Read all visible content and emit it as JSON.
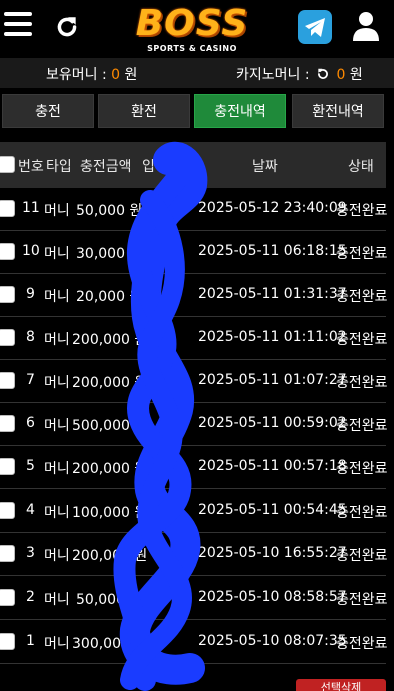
{
  "header": {
    "logo_text": "BOSS",
    "logo_subtext": "SPORTS & CASINO"
  },
  "balance": {
    "holding_label": "보유머니 :",
    "holding_value": "0",
    "holding_unit": "원",
    "casino_label": "카지노머니 :",
    "casino_value": "0",
    "casino_unit": "원"
  },
  "tabs": [
    {
      "label": "충전"
    },
    {
      "label": "환전"
    },
    {
      "label": "충전내역"
    },
    {
      "label": "환전내역"
    }
  ],
  "table": {
    "headers": {
      "no": "번호",
      "type": "타입",
      "amount": "충전금액",
      "in": "입",
      "date": "날짜",
      "status": "상태"
    },
    "rows": [
      {
        "no": "11",
        "type": "머니",
        "amount": "50,000 원",
        "date": "2025-05-12 23:40:09",
        "status": "충전완료"
      },
      {
        "no": "10",
        "type": "머니",
        "amount": "30,000 원",
        "date": "2025-05-11 06:18:15",
        "status": "충전완료"
      },
      {
        "no": "9",
        "type": "머니",
        "amount": "20,000 원",
        "date": "2025-05-11 01:31:37",
        "status": "충전완료"
      },
      {
        "no": "8",
        "type": "머니",
        "amount": "200,000 원",
        "date": "2025-05-11 01:11:02",
        "status": "충전완료"
      },
      {
        "no": "7",
        "type": "머니",
        "amount": "200,000 원",
        "date": "2025-05-11 01:07:27",
        "status": "충전완료"
      },
      {
        "no": "6",
        "type": "머니",
        "amount": "500,000 원",
        "date": "2025-05-11 00:59:02",
        "status": "충전완료"
      },
      {
        "no": "5",
        "type": "머니",
        "amount": "200,000 원",
        "date": "2025-05-11 00:57:18",
        "status": "충전완료"
      },
      {
        "no": "4",
        "type": "머니",
        "amount": "100,000 원",
        "date": "2025-05-11 00:54:45",
        "status": "충전완료"
      },
      {
        "no": "3",
        "type": "머니",
        "amount": "200,000 원",
        "date": "2025-05-10 16:55:27",
        "status": "충전완료"
      },
      {
        "no": "2",
        "type": "머니",
        "amount": "50,000 원",
        "date": "2025-05-10 08:58:57",
        "status": "충전완료"
      },
      {
        "no": "1",
        "type": "머니",
        "amount": "300,000 원",
        "date": "2025-05-10 08:07:35",
        "status": "충전완료"
      }
    ]
  },
  "bottom_button": "선택삭제",
  "colors": {
    "accent_green": "#1f8a3a",
    "accent_orange": "#ff8a00",
    "scribble_blue": "#1a3cff",
    "delete_red": "#c02222"
  }
}
